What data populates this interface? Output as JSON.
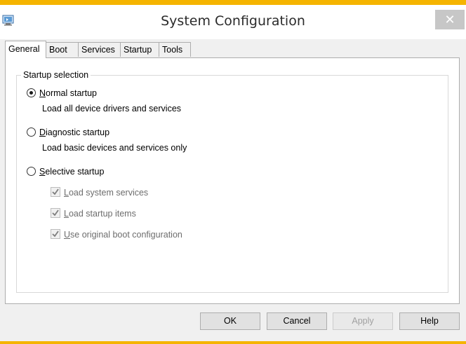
{
  "window": {
    "title": "System Configuration",
    "close_glyph": "✕",
    "app_icon": "msconfig-icon",
    "accent": "#f5b400"
  },
  "tabs": [
    {
      "label": "General",
      "active": true
    },
    {
      "label": "Boot"
    },
    {
      "label": "Services"
    },
    {
      "label": "Startup"
    },
    {
      "label": "Tools"
    }
  ],
  "startup_selection": {
    "legend": "Startup selection",
    "selected": "normal",
    "options": [
      {
        "key": "N",
        "rest": "ormal startup",
        "description": "Load all device drivers and services"
      },
      {
        "key": "D",
        "rest": "iagnostic startup",
        "description": "Load basic devices and services only"
      },
      {
        "key": "S",
        "rest": "elective startup",
        "description": ""
      }
    ],
    "selective_items": [
      {
        "key": "L",
        "rest": "oad system services",
        "checked": true,
        "enabled": false
      },
      {
        "key": "L",
        "rest": "oad startup items",
        "checked": true,
        "enabled": false
      },
      {
        "key": "U",
        "rest": "se original boot configuration",
        "checked": true,
        "enabled": false
      }
    ]
  },
  "buttons": {
    "ok": "OK",
    "cancel": "Cancel",
    "apply": "Apply",
    "help": "Help"
  }
}
